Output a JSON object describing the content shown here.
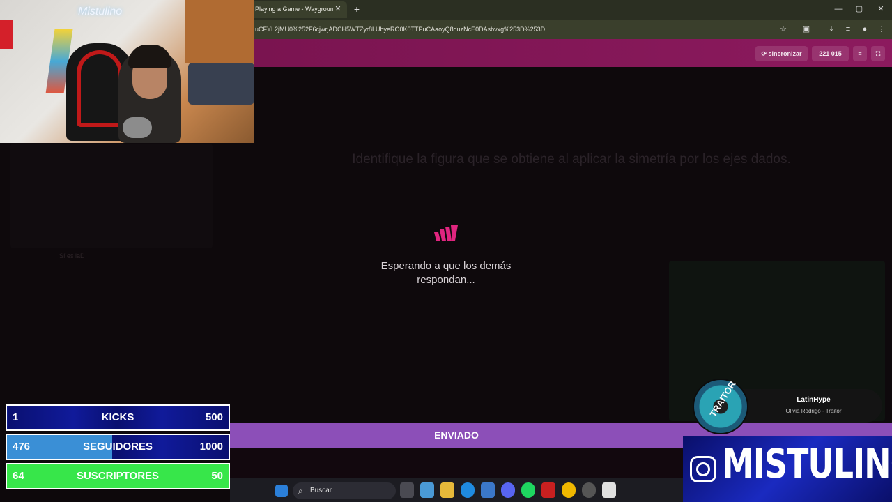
{
  "browser": {
    "tab_title": "Playing a Game - Wayground (",
    "tab_close": "✕",
    "new_tab": "+",
    "url": "uCFYL2jMU0%252F6cjwrjADCH5WTZyr8LUbyeRO0K0TTPuCAaoyQ8duzNcE0DAsbvxg%253D%253D",
    "window_controls": [
      "—",
      "▢",
      "✕"
    ]
  },
  "header": {
    "sync_label": "⟳ sincronizar",
    "score": "221 015"
  },
  "quiz": {
    "question": "Identifique la figura que se obtiene al aplicar la simetría por los ejes dados.",
    "waiting_line1": "Esperando a que los demás",
    "waiting_line2": "respondan...",
    "submitted_label": "ENVIADO"
  },
  "chat_ghost": {
    "text": "Sí es laD"
  },
  "webcam": {
    "neon_sign": "Mistulino"
  },
  "goals": [
    {
      "current": "1",
      "label": "KICKS",
      "target": "500",
      "color": "#0d1a8a",
      "progress": 0.002
    },
    {
      "current": "476",
      "label": "SEGUIDORES",
      "target": "1000",
      "color": "#3a8fd6",
      "progress": 0.476
    },
    {
      "current": "64",
      "label": "SUSCRIPTORES",
      "target": "50",
      "color": "#37e64a",
      "progress": 1.0
    }
  ],
  "music": {
    "artist": "LatinHype",
    "track": "Olivia Rodrigo - Traitor",
    "disc_label": "TRAITOR"
  },
  "brand": {
    "name": "MISTULINO"
  },
  "taskbar": {
    "search_placeholder": "Buscar"
  }
}
